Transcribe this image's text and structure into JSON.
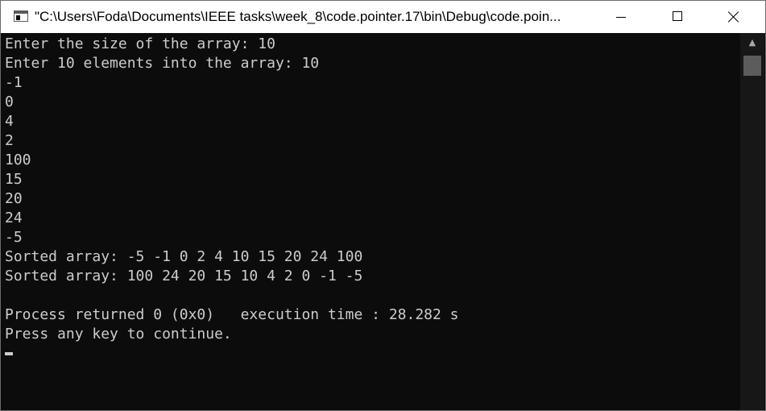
{
  "window": {
    "title": "\"C:\\Users\\Foda\\Documents\\IEEE tasks\\week_8\\code.pointer.17\\bin\\Debug\\code.poin..."
  },
  "console": {
    "lines": [
      "Enter the size of the array: 10",
      "Enter 10 elements into the array: 10",
      "-1",
      "0",
      "4",
      "2",
      "100",
      "15",
      "20",
      "24",
      "-5",
      "Sorted array: -5 -1 0 2 4 10 15 20 24 100",
      "Sorted array: 100 24 20 15 10 4 2 0 -1 -5",
      "",
      "Process returned 0 (0x0)   execution time : 28.282 s",
      "Press any key to continue."
    ]
  },
  "icons": {
    "app": "console-window-icon",
    "minimize": "minimize-icon",
    "maximize": "maximize-icon",
    "close": "close-icon",
    "scroll_up": "chevron-up-icon"
  },
  "colors": {
    "console_background": "#0c0c0c",
    "console_text": "#cccccc",
    "titlebar_background": "#ffffff"
  }
}
